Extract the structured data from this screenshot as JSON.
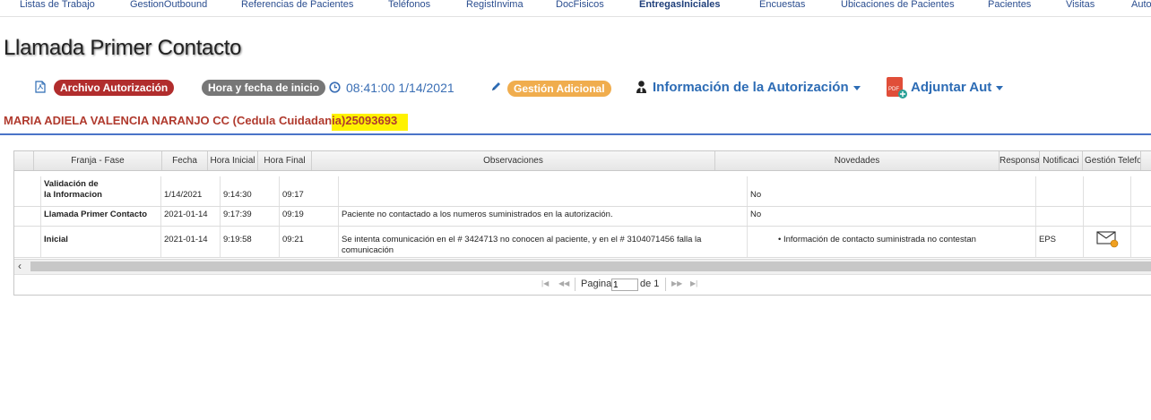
{
  "nav": [
    "Listas de Trabajo",
    "GestionOutbound",
    "Referencias de Pacientes",
    "Teléfonos",
    "RegistInvima",
    "DocFisicos",
    "EntregasIniciales",
    "Encuestas",
    "Ubicaciones de Pacientes",
    "Pacientes",
    "Visitas",
    "Auto"
  ],
  "nav_active": "EntregasIniciales",
  "page_title": "Llamada Primer Contacto",
  "toolbar": {
    "archivo_label": "Archivo Autorización",
    "hora_badge": "Hora y fecha de inicio",
    "hora_value": "08:41:00 1/14/2021",
    "gestion_label": "Gestión Adicional",
    "info_label": "Información de la Autorización",
    "adjuntar_label": "Adjuntar Aut"
  },
  "patient": {
    "name_text": "MARIA ADIELA VALENCIA NARANJO CC (Cedula Cuidadan",
    "highlighted_text": "ia)25093693"
  },
  "table": {
    "headers": [
      "Franja - Fase",
      "Fecha",
      "Hora Inicial",
      "Hora Final",
      "Observaciones",
      "Novedades",
      "Responsa",
      "Notificaci",
      "Gestión Telefo"
    ],
    "rows": [
      {
        "fase_line1": "Validación de",
        "fase_line2": "la Informacion",
        "fecha": "1/14/2021",
        "hora_inicial": "9:14:30",
        "hora_final": "09:17",
        "observaciones": "",
        "novedades": "No",
        "responsable": "",
        "notificacion": ""
      },
      {
        "fase_line1": "Llamada Primer Contacto",
        "fase_line2": "",
        "fecha": "2021-01-14",
        "hora_inicial": "9:17:39",
        "hora_final": "09:19",
        "observaciones": "Paciente no contactado a los numeros suministrados en la autorización.",
        "novedades": "No",
        "responsable": "",
        "notificacion": ""
      },
      {
        "fase_line1": "Inicial",
        "fase_line2": "",
        "fecha": "2021-01-14",
        "hora_inicial": "9:19:58",
        "hora_final": "09:21",
        "observaciones": "Se intenta comunicación en el # 3424713 no conocen al paciente, y en el # 3104071456 falla la comunicación",
        "novedades": "Información de contacto suministrada no contestan",
        "responsable": "EPS",
        "notificacion": ""
      }
    ]
  },
  "pager": {
    "pagina_label": "Pagina",
    "page_value": "1",
    "de_label": "de 1"
  },
  "icons": [
    "pdf-file-icon",
    "clock-icon",
    "pencil-icon",
    "user-icon",
    "pdf-add-icon",
    "envelope-icon"
  ],
  "colors": {
    "link": "#2d6cb5",
    "badge_red": "#b12d2d",
    "badge_orange": "#f0ad4e",
    "highlight": "#fff200",
    "patient": "#b03a2e"
  }
}
